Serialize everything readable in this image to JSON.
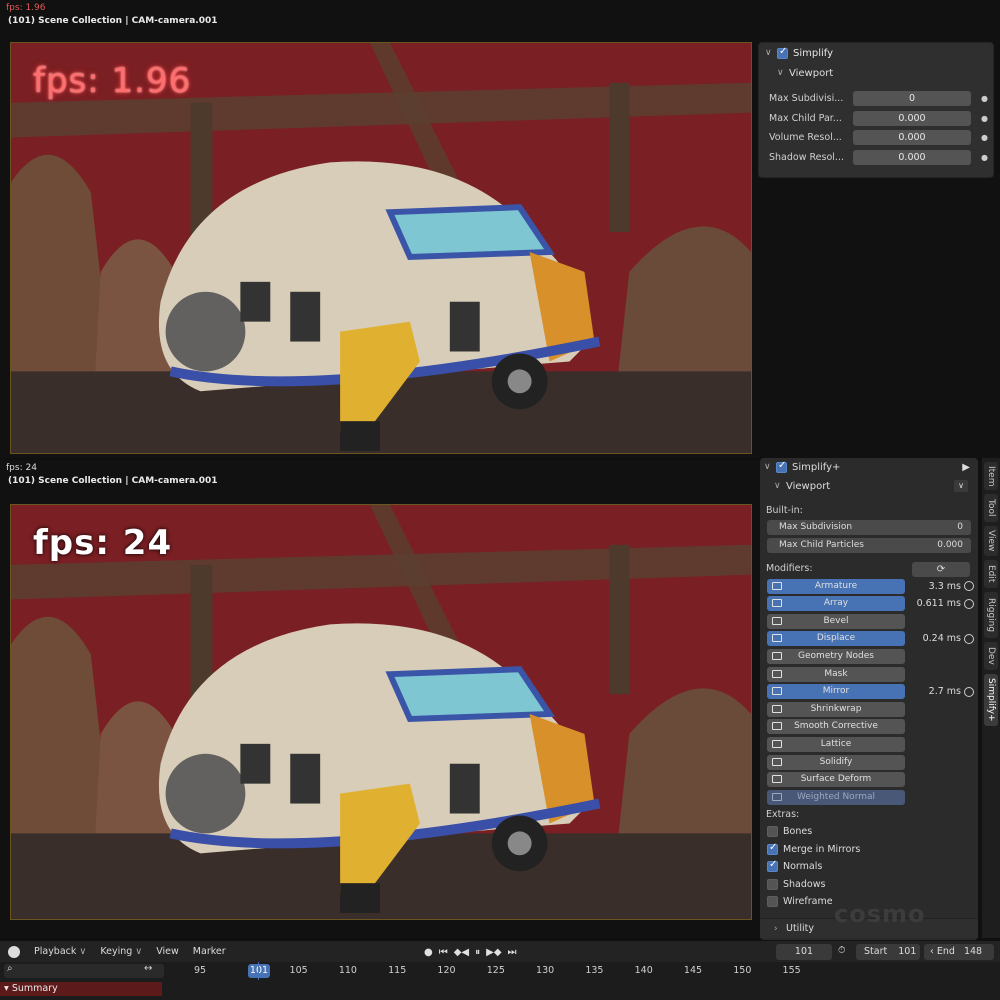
{
  "top_viewport": {
    "fps_label": "fps: 1.96",
    "info": "(101) Scene Collection | CAM-camera.001",
    "overlay_fps": "fps: 1.96"
  },
  "top_panel": {
    "title": "Simplify",
    "subtitle": "Viewport",
    "rows": [
      {
        "label": "Max Subdivisi...",
        "value": "0"
      },
      {
        "label": "Max Child Par...",
        "value": "0.000"
      },
      {
        "label": "Volume Resol...",
        "value": "0.000"
      },
      {
        "label": "Shadow Resol...",
        "value": "0.000"
      }
    ]
  },
  "bottom_viewport": {
    "fps_label": "fps: 24",
    "info": "(101) Scene Collection | CAM-camera.001",
    "overlay_fps": "fps: 24"
  },
  "bottom_panel": {
    "title": "Simplify+",
    "subtitle": "Viewport",
    "builtin_label": "Built-in:",
    "builtin": [
      {
        "label": "Max Subdivision",
        "value": "0"
      },
      {
        "label": "Max Child Particles",
        "value": "0.000"
      }
    ],
    "modifiers_label": "Modifiers:",
    "modifiers": [
      {
        "label": "Armature",
        "active": true,
        "time": "3.3 ms"
      },
      {
        "label": "Array",
        "active": true,
        "time": "0.611 ms"
      },
      {
        "label": "Bevel",
        "active": false,
        "time": ""
      },
      {
        "label": "Displace",
        "active": true,
        "time": "0.24 ms"
      },
      {
        "label": "Geometry Nodes",
        "active": false,
        "time": ""
      },
      {
        "label": "Mask",
        "active": false,
        "time": ""
      },
      {
        "label": "Mirror",
        "active": true,
        "time": "2.7 ms"
      },
      {
        "label": "Shrinkwrap",
        "active": false,
        "time": ""
      },
      {
        "label": "Smooth Corrective",
        "active": false,
        "time": ""
      },
      {
        "label": "Lattice",
        "active": false,
        "time": ""
      },
      {
        "label": "Solidify",
        "active": false,
        "time": ""
      },
      {
        "label": "Surface Deform",
        "active": false,
        "time": ""
      },
      {
        "label": "Weighted Normal",
        "active": false,
        "time": ""
      }
    ],
    "extras_label": "Extras:",
    "extras": [
      {
        "label": "Bones",
        "checked": false
      },
      {
        "label": "Merge in Mirrors",
        "checked": true
      },
      {
        "label": "Normals",
        "checked": true
      },
      {
        "label": "Shadows",
        "checked": false
      },
      {
        "label": "Wireframe",
        "checked": false
      }
    ],
    "utility_label": "Utility",
    "watermark": "cosmo"
  },
  "side_tabs": [
    "Item",
    "Tool",
    "View",
    "Edit",
    "Rigging",
    "Dev",
    "Simplify+"
  ],
  "timeline": {
    "menus": [
      "Playback",
      "Keying",
      "View",
      "Marker"
    ],
    "current_frame": "101",
    "start_label": "Start",
    "start": "101",
    "end_label": "End",
    "end": "148",
    "ticks": [
      "95",
      "101",
      "105",
      "110",
      "115",
      "120",
      "125",
      "130",
      "135",
      "140",
      "145",
      "150",
      "155"
    ],
    "summary": "Summary"
  },
  "colors": {
    "accent": "#4772b3",
    "backdrop": "#7a1f23"
  }
}
